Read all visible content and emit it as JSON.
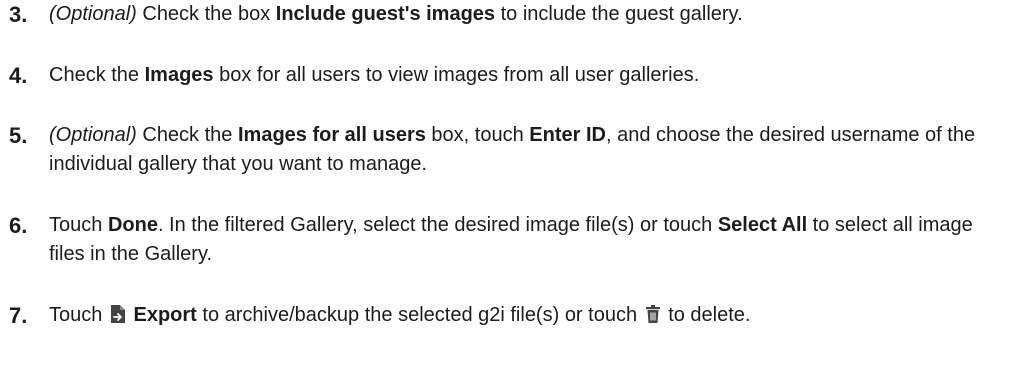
{
  "steps": [
    {
      "number": "3.",
      "segments": [
        "(Optional)",
        " Check the box ",
        "Include guest's images",
        " to include the guest gallery."
      ]
    },
    {
      "number": "4.",
      "segments": [
        "Check the ",
        "Images",
        " box for all users to view images from all user galleries."
      ]
    },
    {
      "number": "5.",
      "segments": [
        "(Optional)",
        " Check the ",
        "Images for all users",
        " box, touch ",
        "Enter ID",
        ", and choose the desired username of the individual gallery that you want to manage."
      ]
    },
    {
      "number": "6.",
      "segments": [
        "Touch ",
        "Done",
        ". In the filtered Gallery, select the desired image file(s) or touch ",
        "Select All",
        " to select all image files in the Gallery."
      ]
    },
    {
      "number": "7.",
      "segments": [
        "Touch ",
        "Export",
        " to archive/backup the selected g2i file(s) or touch ",
        " to delete."
      ],
      "icons": [
        "export-icon",
        "trash-icon"
      ]
    }
  ]
}
